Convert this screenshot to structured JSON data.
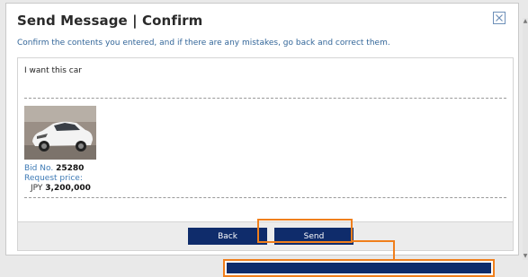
{
  "dialog": {
    "title": "Send Message | Confirm",
    "subtitle": "Confirm the contents you entered, and if there are any mistakes, go back and correct them.",
    "close_icon": "close-icon"
  },
  "message": {
    "text": "I want this car"
  },
  "listing": {
    "image_icon": "car-photo",
    "bid_label": "Bid No.",
    "bid_value": "25280",
    "price_label": "Request price:",
    "currency": "JPY",
    "price_value": "3,200,000"
  },
  "footer": {
    "back_label": "Back",
    "send_label": "Send"
  },
  "colors": {
    "button_bg": "#0f2c6b",
    "highlight": "#f07f1c",
    "link_blue": "#3d7ab5"
  }
}
